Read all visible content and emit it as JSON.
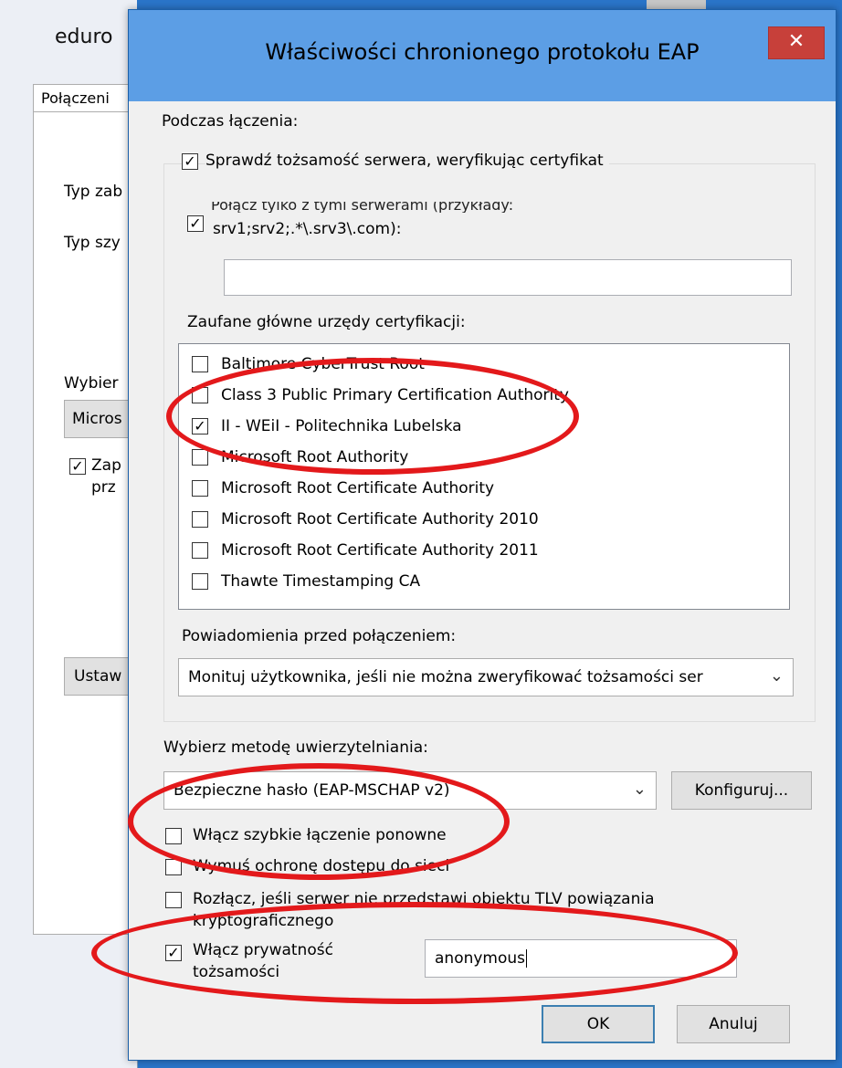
{
  "background_window": {
    "title": "eduro",
    "tab": "Połączeni",
    "labels": [
      "Typ zab",
      "Typ szy",
      "Wybier"
    ],
    "combo_value": "Micros",
    "checkbox_label_line1": "Zap",
    "checkbox_label_line2": "prz",
    "button": "Ustaw"
  },
  "dialog": {
    "title": "Właściwości chronionego protokołu EAP",
    "close_glyph": "✕",
    "connecting_heading": "Podczas łączenia:",
    "verify_server_label": "Sprawdź tożsamość serwera, weryfikując certyfikat",
    "verify_server_checked": true,
    "connect_servers_label_line1": "Połącz tylko z tymi serwerami (przykłady:",
    "connect_servers_label_line2": "srv1;srv2;.*\\.srv3\\.com):",
    "connect_servers_checked": true,
    "servers_value": "",
    "trusted_ca_label": "Zaufane główne urzędy certyfikacji:",
    "trusted_ca": [
      {
        "name": "Baltimore CyberTrust Root",
        "checked": false
      },
      {
        "name": "Class 3 Public Primary Certification Authority",
        "checked": false
      },
      {
        "name": "II - WEiI - Politechnika Lubelska",
        "checked": true
      },
      {
        "name": "Microsoft Root Authority",
        "checked": false
      },
      {
        "name": "Microsoft Root Certificate Authority",
        "checked": false
      },
      {
        "name": "Microsoft Root Certificate Authority 2010",
        "checked": false
      },
      {
        "name": "Microsoft Root Certificate Authority 2011",
        "checked": false
      },
      {
        "name": "Thawte Timestamping CA",
        "checked": false
      }
    ],
    "notifications_label": "Powiadomienia przed połączeniem:",
    "notifications_value": "Monituj użytkownika, jeśli nie można zweryfikować tożsamości ser",
    "auth_method_label": "Wybierz metodę uwierzytelniania:",
    "auth_method_value": "Bezpieczne hasło (EAP-MSCHAP v2)",
    "configure_button": "Konfiguruj...",
    "fast_reconnect_label": "Włącz szybkie łączenie ponowne",
    "fast_reconnect_checked": false,
    "enforce_nap_label": "Wymuś ochronę dostępu do sieci",
    "enforce_nap_checked": false,
    "disconnect_tlv_label_line1": "Rozłącz, jeśli serwer nie przedstawi obiektu TLV powiązania",
    "disconnect_tlv_label_line2": "kryptograficznego",
    "disconnect_tlv_checked": false,
    "identity_privacy_label_line1": "Włącz prywatność",
    "identity_privacy_label_line2": "tożsamości",
    "identity_privacy_checked": true,
    "identity_value": "anonymous",
    "ok_button": "OK",
    "cancel_button": "Anuluj"
  },
  "colors": {
    "titlebar": "#5c9ee5",
    "close_button": "#c7403a",
    "annotation_ellipse": "#e3191b",
    "dialog_bg": "#f0f0f0"
  }
}
